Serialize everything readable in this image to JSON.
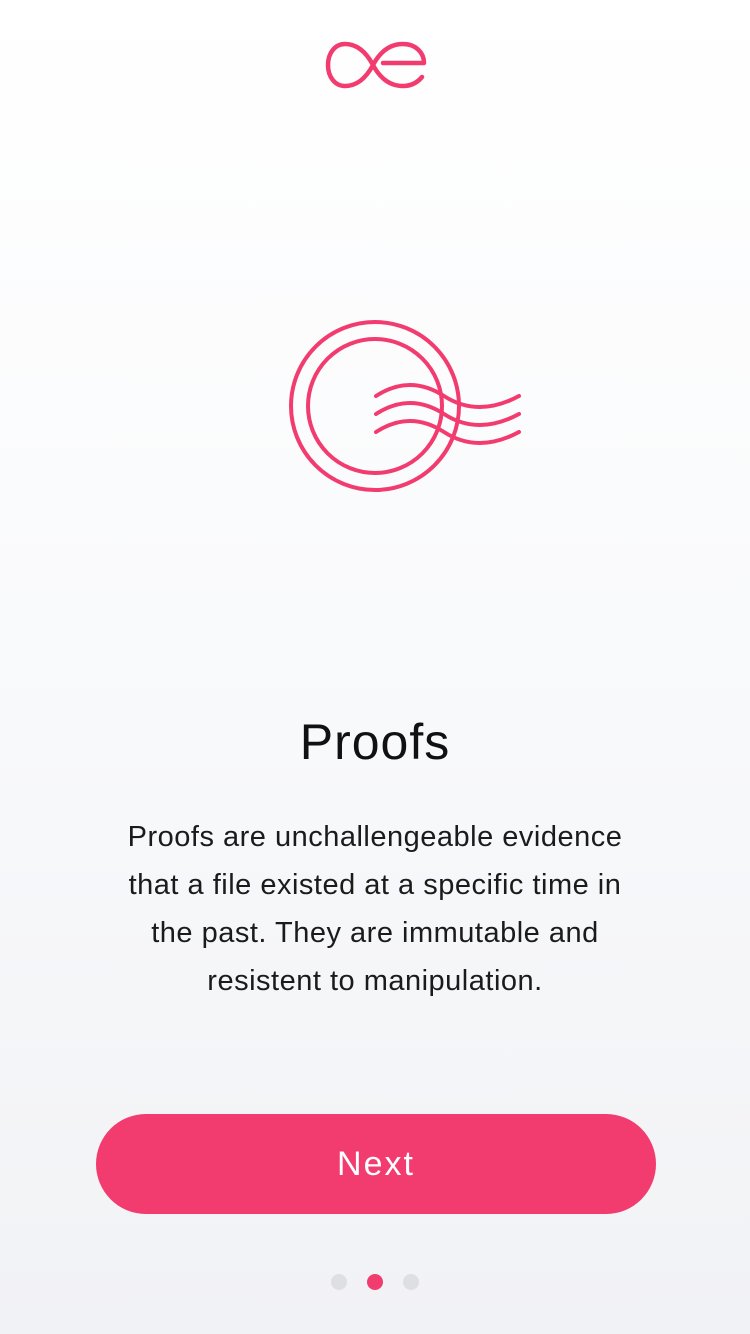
{
  "app": {
    "logo_icon": "brand-infinity-e-logo",
    "accent_color": "#f23b6f"
  },
  "onboarding": {
    "illustration_icon": "postmark-stamp-icon",
    "title": "Proofs",
    "description": "Proofs are unchallengeable evidence\nthat a file existed at a specific time in\nthe past. They are immutable and\nresistent to manipulation.",
    "next_label": "Next",
    "page_index": 2,
    "page_count": 3
  }
}
